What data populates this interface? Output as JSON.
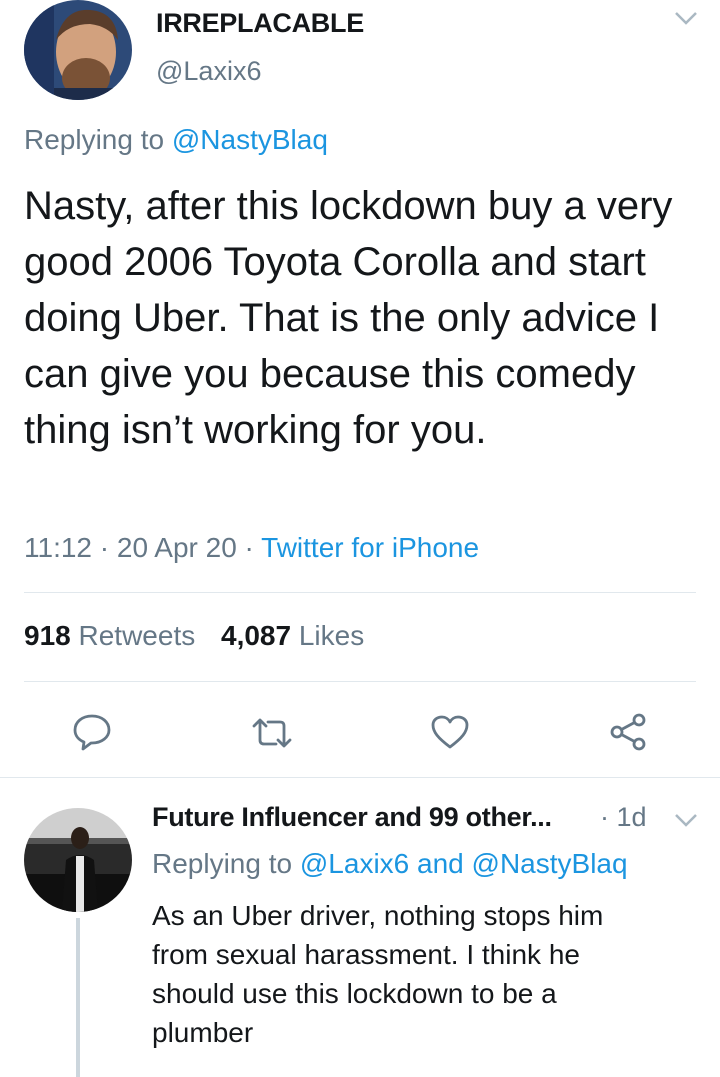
{
  "tweet": {
    "display_name": "IRREPLACABLE",
    "handle": "@Laxix6",
    "replying_prefix": "Replying to",
    "replying_to": "@NastyBlaq",
    "text": "Nasty, after this lockdown buy a very good 2006 Toyota Corolla and start doing Uber. That is the only advice I can give you because this comedy thing isn’t working for you.",
    "time": "11:12",
    "date": "20 Apr 20",
    "separator": "·",
    "source": "Twitter for iPhone",
    "retweet_count": "918",
    "retweet_label": "Retweets",
    "like_count": "4,087",
    "like_label": "Likes"
  },
  "reply": {
    "display_name": "Future Influencer and 99 other...",
    "age": "· 1d",
    "replying_prefix": "Replying to",
    "replying_to_1": "@Laxix6",
    "and_word": "and",
    "replying_to_2": "@NastyBlaq",
    "text": "As an Uber driver, nothing stops him from sexual harassment. I think he should use this lockdown to be a plumber"
  },
  "icons": {
    "reply": "speech-bubble-icon",
    "retweet": "retweet-arrows-icon",
    "like": "heart-icon",
    "share": "share-nodes-icon",
    "menu": "chevron-down-icon"
  },
  "colors": {
    "link": "#1b95e0",
    "secondary_text": "#657786",
    "divider": "#e1e8ed"
  }
}
